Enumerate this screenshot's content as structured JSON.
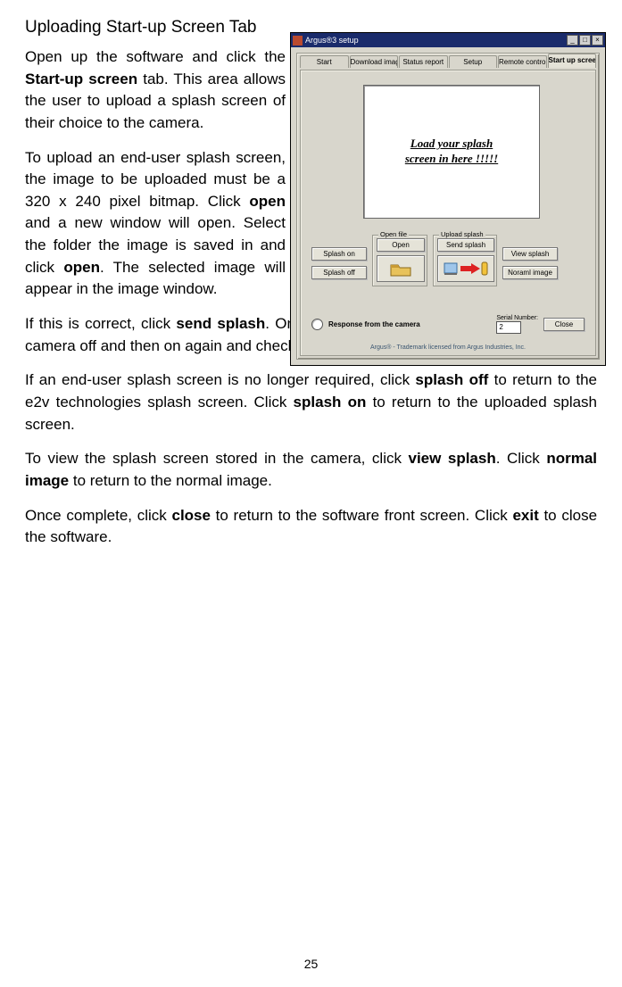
{
  "heading": "Uploading Start-up Screen Tab",
  "paragraphs_narrow": [
    {
      "pre": "Open up the software and click the ",
      "b1": "Start-up screen",
      "mid": " tab. This area allows the user to upload a splash screen of their choice to the camera.",
      "b2": "",
      "post": ""
    },
    {
      "pre": "To upload an end-user splash screen, the image to be uploaded must be a 320 x 240 pixel bitmap. Click ",
      "b1": "open",
      "mid": " and a new window will open. Select the folder the image is saved in and click ",
      "b2": "open",
      "post": ". The selected image will appear in the image window."
    }
  ],
  "paragraphs_full": [
    {
      "pre": "If this is correct, click ",
      "b1": "send splash",
      "mid": ". Once the upload has been completed, turn the camera off and then on again and check the selected image is the splash screen.",
      "b2": "",
      "post": ""
    },
    {
      "pre": "If an end-user splash screen is no longer required, click ",
      "b1": "splash off",
      "mid": " to return to the e2v technologies splash screen. Click ",
      "b2": "splash on",
      "post": " to return to the uploaded splash screen."
    },
    {
      "pre": "To view the splash screen stored in the camera, click ",
      "b1": "view splash",
      "mid": ". Click ",
      "b2": "normal image",
      "post": " to return to the normal image."
    },
    {
      "pre": "Once complete, click ",
      "b1": "close",
      "mid": " to return to the software front screen. Click ",
      "b2": "exit",
      "post": " to close the software."
    }
  ],
  "page_number": "25",
  "fig": {
    "title": "Argus®3 setup",
    "tabs": [
      "Start",
      "Download image",
      "Status report",
      "Setup",
      "Remote control",
      "Start up screen"
    ],
    "preview_text": "Load your splash\nscreen in here !!!!!",
    "btns": {
      "splash_on": "Splash on",
      "splash_off": "Splash off",
      "open_lbl": "Open file",
      "open_btn": "Open",
      "upload_lbl": "Upload splash",
      "send_splash": "Send splash",
      "view_splash": "View splash",
      "normal_image": "Noraml image"
    },
    "response_label": "Response from the camera",
    "serial_label": "Serial Number:",
    "serial_value": "2",
    "close": "Close",
    "trademark": "Argus® - Trademark licensed from Argus Industries, Inc."
  }
}
